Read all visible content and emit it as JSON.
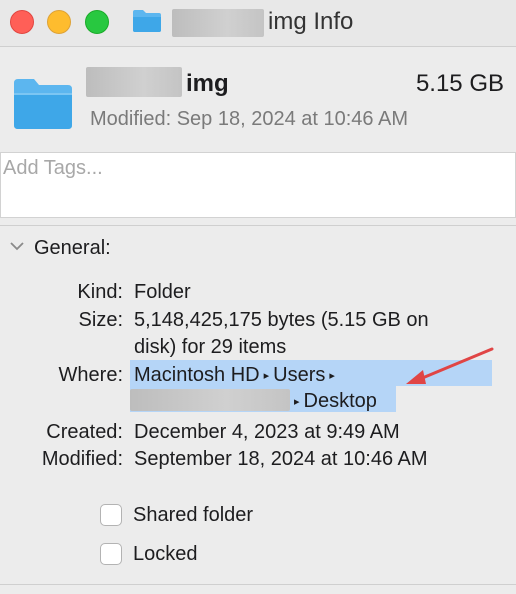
{
  "window": {
    "title_suffix": "img Info"
  },
  "header": {
    "name_suffix": "img",
    "size": "5.15 GB",
    "modified": "Modified: Sep 18, 2024 at 10:46 AM"
  },
  "tags": {
    "placeholder": "Add Tags..."
  },
  "general": {
    "section_label": "General:",
    "kind_label": "Kind:",
    "kind_value": "Folder",
    "size_label": "Size:",
    "size_value_line1": "5,148,425,175 bytes (5.15 GB on",
    "size_value_line2": "disk) for 29 items",
    "where_label": "Where:",
    "where_path": [
      "Macintosh HD",
      "Users",
      "Desktop"
    ],
    "created_label": "Created:",
    "created_value": "December 4, 2023 at 9:49 AM",
    "modified_label": "Modified:",
    "modified_value": "September 18, 2024 at 10:46 AM"
  },
  "options": {
    "shared_folder_label": "Shared folder",
    "shared_folder_checked": false,
    "locked_label": "Locked",
    "locked_checked": false
  },
  "colors": {
    "folder_blue": "#3ea7e8",
    "selection_highlight": "#b5d5f7",
    "annotation_arrow": "#e04545"
  }
}
